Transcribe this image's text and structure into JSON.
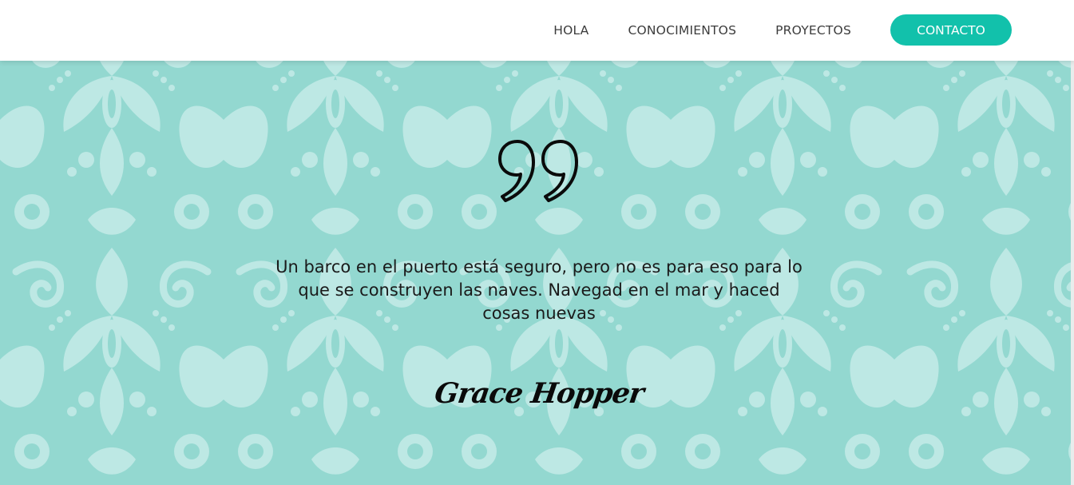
{
  "nav": {
    "items": [
      {
        "label": "HOLA"
      },
      {
        "label": "CONOCIMIENTOS"
      },
      {
        "label": "PROYECTOS"
      }
    ],
    "contact_label": "CONTACTO"
  },
  "quote": {
    "text": "Un barco en el puerto está seguro, pero no es para eso para lo que se construyen las naves. Navegad en el mar y haced cosas nuevas",
    "author": "Grace Hopper"
  },
  "colors": {
    "accent": "#12c1ab",
    "background": "#93d8d0",
    "pattern_light": "#bde8e4",
    "header_bg": "#ffffff",
    "text": "#1a1a1a"
  },
  "icons": {
    "quote": "closing-quote-icon"
  }
}
